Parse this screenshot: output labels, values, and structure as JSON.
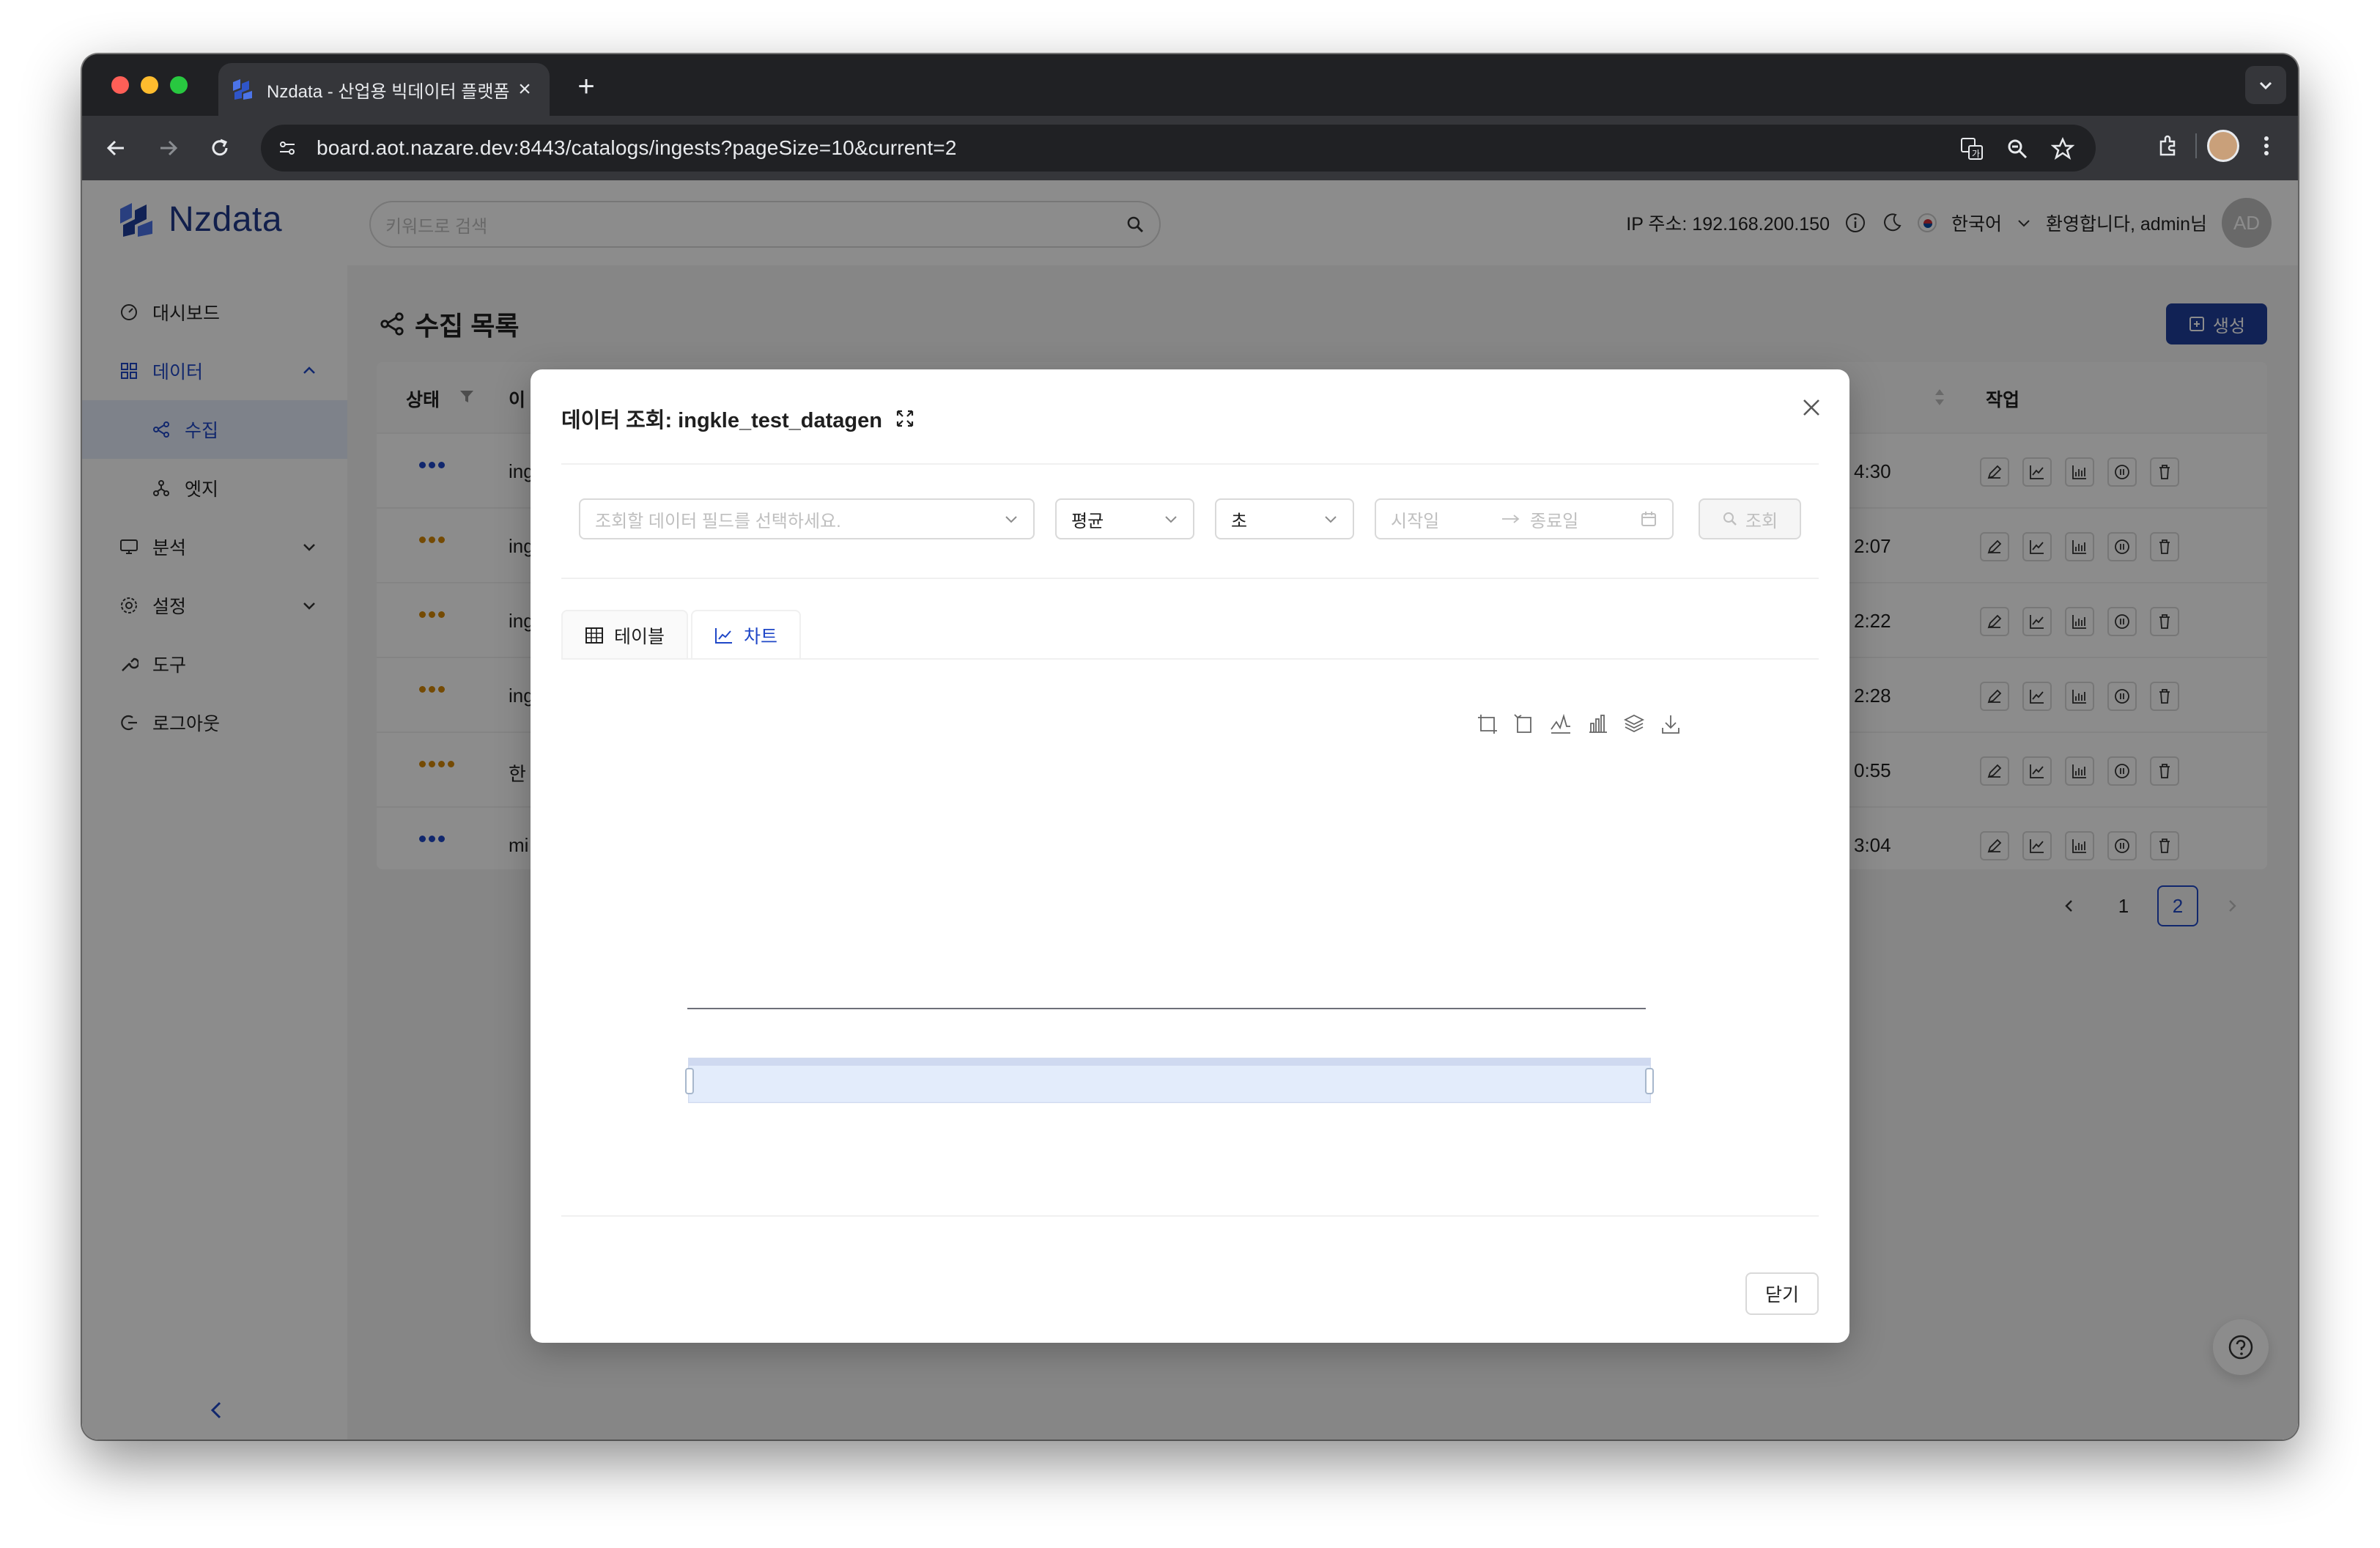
{
  "browser": {
    "tab_title": "Nzdata - 산업용 빅데이터 플랫폼",
    "url": "board.aot.nazare.dev:8443/catalogs/ingests?pageSize=10&current=2"
  },
  "app": {
    "logo_text": "Nzdata",
    "search_placeholder": "키워드로 검색",
    "ip_text": "IP 주소: 192.168.200.150",
    "language": "한국어",
    "welcome": "환영합니다, admin님",
    "avatar_initials": "AD",
    "brand_color": "#1f3f9c",
    "accent_color": "#1f47c7"
  },
  "sidebar": {
    "items": [
      {
        "label": "대시보드",
        "icon": "dashboard-icon"
      },
      {
        "label": "데이터",
        "icon": "data-grid-icon",
        "expanded": true
      },
      {
        "label": "수집",
        "icon": "share-icon",
        "active": true
      },
      {
        "label": "엣지",
        "icon": "edge-nodes-icon"
      },
      {
        "label": "분석",
        "icon": "monitor-icon"
      },
      {
        "label": "설정",
        "icon": "gear-icon"
      },
      {
        "label": "도구",
        "icon": "wrench-icon"
      },
      {
        "label": "로그아웃",
        "icon": "logout-icon"
      }
    ]
  },
  "main": {
    "title": "수집 목록",
    "create_label": "생성",
    "columns": [
      "상태",
      "이",
      "작업"
    ],
    "rows": [
      {
        "name": "ing",
        "time": "4:30",
        "status_color": "#1f47c7",
        "dots": 3
      },
      {
        "name": "ing",
        "time": "2:07",
        "status_color": "#d48806",
        "dots": 3
      },
      {
        "name": "ing",
        "time": "2:22",
        "status_color": "#d48806",
        "dots": 3
      },
      {
        "name": "ing",
        "time": "2:28",
        "status_color": "#d48806",
        "dots": 3
      },
      {
        "name": "한",
        "time": "0:55",
        "status_color": "#d48806",
        "dots": 4
      },
      {
        "name": "mi",
        "time": "3:04",
        "status_color": "#1f47c7",
        "dots": 3
      }
    ],
    "pagination": {
      "pages": [
        "1",
        "2"
      ],
      "current": "2"
    }
  },
  "modal": {
    "title": "데이터 조회: ingkle_test_datagen",
    "field_placeholder": "조회할 데이터 필드를 선택하세요.",
    "aggregate_value": "평균",
    "unit_value": "초",
    "start_placeholder": "시작일",
    "end_placeholder": "종료일",
    "query_label": "조회",
    "tabs": [
      {
        "label": "테이블",
        "icon": "table-icon"
      },
      {
        "label": "차트",
        "icon": "line-chart-icon",
        "active": true
      }
    ],
    "chart_toolbox": [
      "zoom-icon",
      "zoom-reset-icon",
      "line-switch-icon",
      "bar-switch-icon",
      "stack-icon",
      "download-icon"
    ],
    "close_label": "닫기"
  },
  "chart_data": {
    "type": "line",
    "title": "",
    "xlabel": "",
    "ylabel": "",
    "series": [],
    "x": [],
    "grid": false,
    "data_zoom": true
  }
}
